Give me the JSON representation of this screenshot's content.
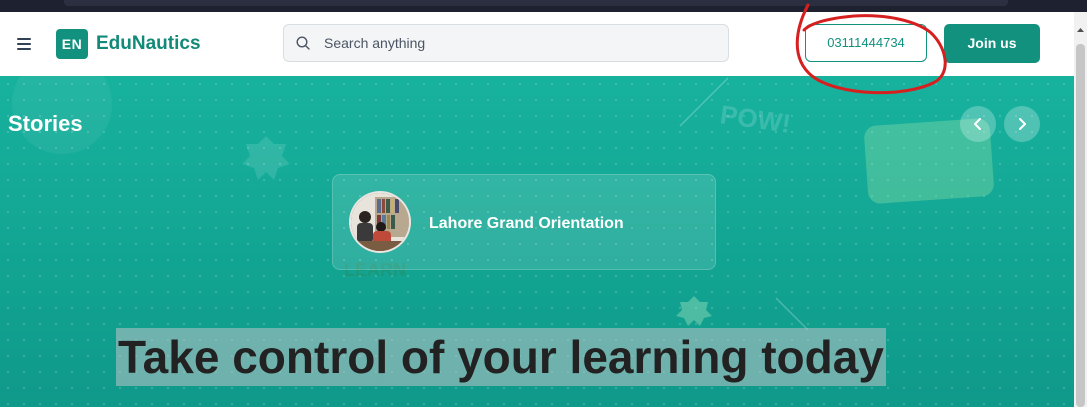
{
  "header": {
    "logo_badge": "EN",
    "logo_text": "EduNautics",
    "search_placeholder": "Search anything",
    "phone_label": "03111444734",
    "join_label": "Join us"
  },
  "hero": {
    "stories_title": "Stories",
    "story_card_title": "Lahore Grand Orientation",
    "headline": "Take control of your learning today",
    "decor_text_pow": "POW!",
    "decor_text_learn": "LEARN"
  },
  "colors": {
    "brand": "#12917f",
    "hero_top": "#17b29e",
    "hero_bottom": "#0f998a",
    "annotation": "#d62020"
  },
  "icons": {
    "menu": "hamburger-icon",
    "search": "search-icon",
    "prev": "chevron-left-icon",
    "next": "chevron-right-icon"
  }
}
